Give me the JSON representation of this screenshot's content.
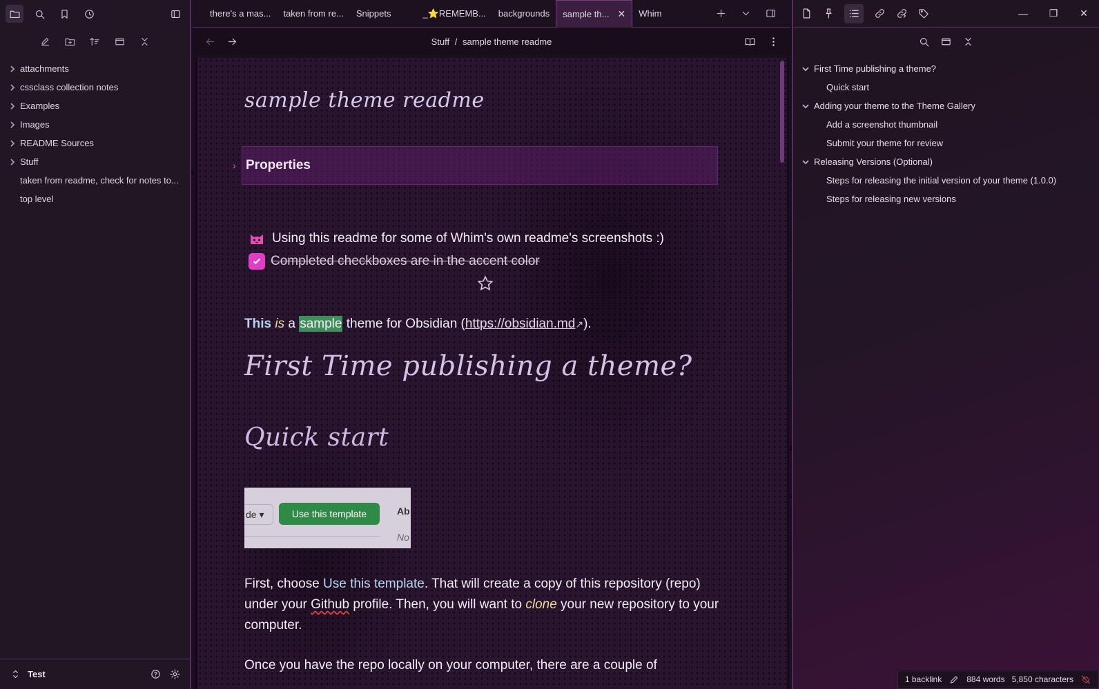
{
  "tabs": [
    {
      "label": "there's a mas..."
    },
    {
      "label": "taken from re..."
    },
    {
      "label": "Snippets"
    },
    {
      "label": "_⭐REMEMB..."
    },
    {
      "label": "backgrounds"
    },
    {
      "label": "sample th...",
      "active": true
    },
    {
      "label": "Whim"
    }
  ],
  "breadcrumb": {
    "folder": "Stuff",
    "separator": "/",
    "note": "sample theme readme"
  },
  "file_tree": [
    {
      "label": "attachments",
      "type": "folder"
    },
    {
      "label": "cssclass collection notes",
      "type": "folder"
    },
    {
      "label": "Examples",
      "type": "folder"
    },
    {
      "label": "Images",
      "type": "folder"
    },
    {
      "label": "README Sources",
      "type": "folder"
    },
    {
      "label": "Stuff",
      "type": "folder"
    },
    {
      "label": "taken from readme, check for notes to...",
      "type": "file"
    },
    {
      "label": "top level",
      "type": "file"
    }
  ],
  "vault": {
    "name": "Test"
  },
  "note": {
    "title": "sample theme readme",
    "properties_label": "Properties",
    "line_cat": "Using this readme for some of Whim's own readme's screenshots :)",
    "line_checked": "Completed checkboxes are in the accent color",
    "intro": {
      "this": "This",
      "is": "is",
      "a": "a",
      "sample": "sample",
      "rest": "theme for Obsidian (",
      "link": "https://obsidian.md",
      "end": ")."
    },
    "h1": "First Time publishing a theme?",
    "h2": "Quick start",
    "template_image": {
      "de": "de ▾",
      "button": "Use this template",
      "ab": "Ab",
      "no": "No"
    },
    "para1": {
      "a": "First, choose ",
      "b": "Use this template",
      "c": ". That will create a copy of this repository (repo) under your ",
      "d": "Github",
      "e": " profile. Then, you will want to ",
      "f": "clone",
      "g": " your new repository to your computer."
    },
    "para2": "Once you have the repo locally on your computer, there are a couple of"
  },
  "outline": [
    {
      "label": "First Time publishing a theme?",
      "level": 1,
      "collapsible": true
    },
    {
      "label": "Quick start",
      "level": 2
    },
    {
      "label": "Adding your theme to the Theme Gallery",
      "level": 1,
      "collapsible": true
    },
    {
      "label": "Add a screenshot thumbnail",
      "level": 2
    },
    {
      "label": "Submit your theme for review",
      "level": 2
    },
    {
      "label": "Releasing Versions (Optional)",
      "level": 1,
      "collapsible": true
    },
    {
      "label": "Steps for releasing the initial version of your theme (1.0.0)",
      "level": 2
    },
    {
      "label": "Steps for releasing new versions",
      "level": 2
    }
  ],
  "status": {
    "backlinks": "1 backlink",
    "words": "884 words",
    "characters": "5,850 characters"
  },
  "colors": {
    "accent": "#e03ec6",
    "border": "#5c2a63",
    "highlight": "#3f8f5b",
    "link_blue": "#b9d4f0"
  }
}
